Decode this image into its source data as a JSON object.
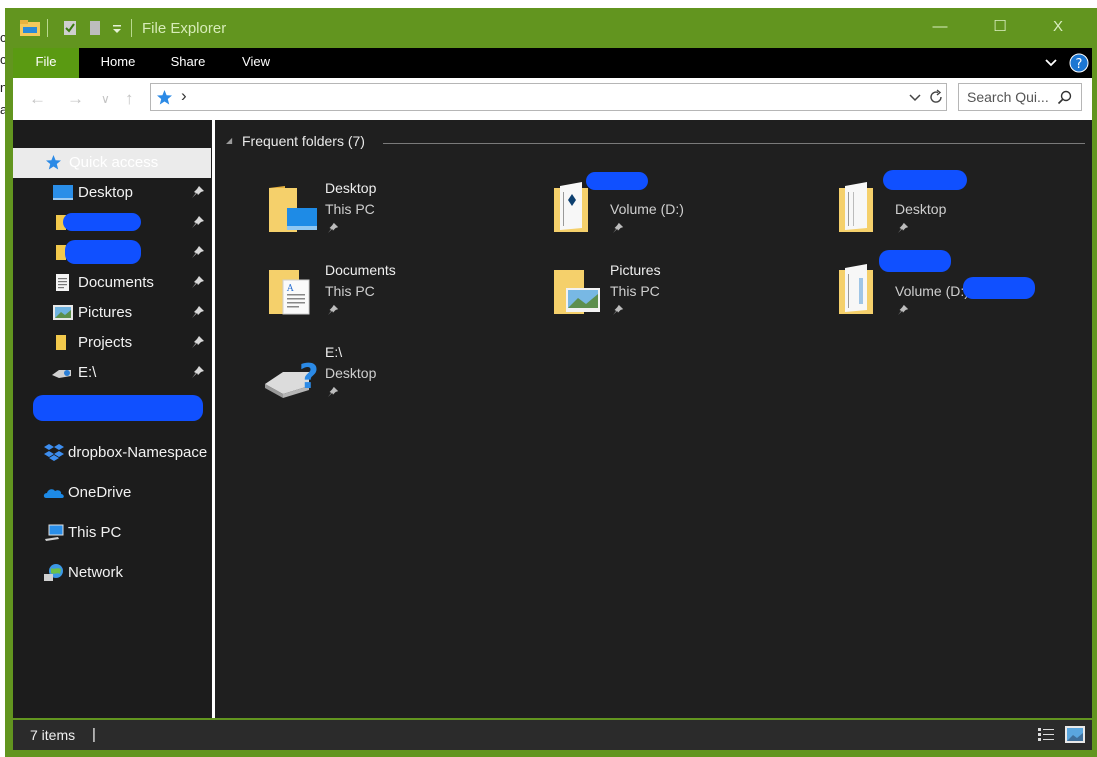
{
  "window": {
    "title": "File Explorer",
    "controls": {
      "minimize": "—",
      "maximize": "☐",
      "close": "X"
    },
    "accent": "#62951f"
  },
  "ribbon": {
    "tabs": [
      "File",
      "Home",
      "Share",
      "View"
    ],
    "collapse_icon": "chevron-down-icon",
    "help_icon": "help-icon"
  },
  "address": {
    "separator": "›",
    "search_placeholder": "Search Qui..."
  },
  "nav_pane": {
    "quick_access_label": "Quick access",
    "pinned": [
      {
        "label": "Desktop",
        "icon": "desktop-icon"
      },
      {
        "label": "",
        "icon": "folder-icon",
        "redacted": true
      },
      {
        "label": "",
        "icon": "folder-icon",
        "redacted": true
      },
      {
        "label": "Documents",
        "icon": "documents-icon"
      },
      {
        "label": "Pictures",
        "icon": "pictures-icon"
      },
      {
        "label": "Projects",
        "icon": "folder-icon"
      },
      {
        "label": "E:\\",
        "icon": "drive-icon"
      }
    ],
    "locations": [
      {
        "label": "dropbox-Namespace",
        "icon": "dropbox-icon"
      },
      {
        "label": "OneDrive",
        "icon": "onedrive-icon"
      },
      {
        "label": "This PC",
        "icon": "this-pc-icon"
      },
      {
        "label": "Network",
        "icon": "network-icon"
      }
    ]
  },
  "content": {
    "group_title": "Frequent folders (7)",
    "tiles": [
      {
        "name": "Desktop",
        "location": "This PC",
        "icon": "desktop-folder-icon"
      },
      {
        "name": "",
        "location": "Volume (D:)",
        "icon": "folder-files-icon",
        "redacted": true
      },
      {
        "name": "",
        "location": "Desktop",
        "icon": "folder-files-icon",
        "redacted": true
      },
      {
        "name": "Documents",
        "location": "This PC",
        "icon": "documents-folder-icon"
      },
      {
        "name": "Pictures",
        "location": "This PC",
        "icon": "pictures-folder-icon"
      },
      {
        "name": "",
        "location": "Volume (D:)",
        "icon": "folder-files-icon",
        "redacted": true
      },
      {
        "name": "E:\\",
        "location": "Desktop",
        "icon": "unknown-drive-icon"
      }
    ]
  },
  "status_bar": {
    "item_count": "7 items",
    "caret": "|",
    "view_icons": [
      "details-view-icon",
      "large-icons-view-icon"
    ]
  }
}
